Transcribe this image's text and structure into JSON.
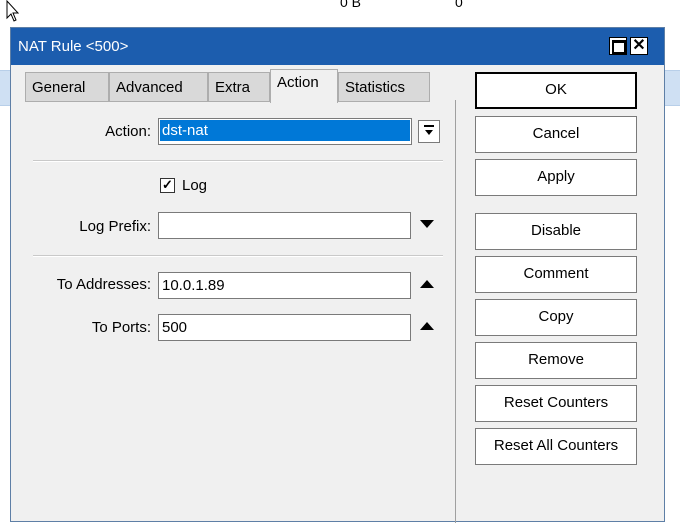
{
  "background": {
    "cells": [
      "0 B",
      "0"
    ]
  },
  "window": {
    "title": "NAT Rule <500>",
    "close_glyph": "✕"
  },
  "tabs": [
    {
      "label": "General",
      "active": false
    },
    {
      "label": "Advanced",
      "active": false
    },
    {
      "label": "Extra",
      "active": false
    },
    {
      "label": "Action",
      "active": true
    },
    {
      "label": "Statistics",
      "active": false
    }
  ],
  "form": {
    "action_label": "Action:",
    "action_value": "dst-nat",
    "log_label": "Log",
    "log_checked": true,
    "log_prefix_label": "Log Prefix:",
    "log_prefix_value": "",
    "to_addresses_label": "To Addresses:",
    "to_addresses_value": "10.0.1.89",
    "to_ports_label": "To Ports:",
    "to_ports_value": "500"
  },
  "buttons": {
    "ok": "OK",
    "cancel": "Cancel",
    "apply": "Apply",
    "disable": "Disable",
    "comment": "Comment",
    "copy": "Copy",
    "remove": "Remove",
    "reset_counters": "Reset Counters",
    "reset_all_counters": "Reset All Counters"
  },
  "colors": {
    "titlebar": "#1c5dae",
    "selection": "#0078d7"
  }
}
